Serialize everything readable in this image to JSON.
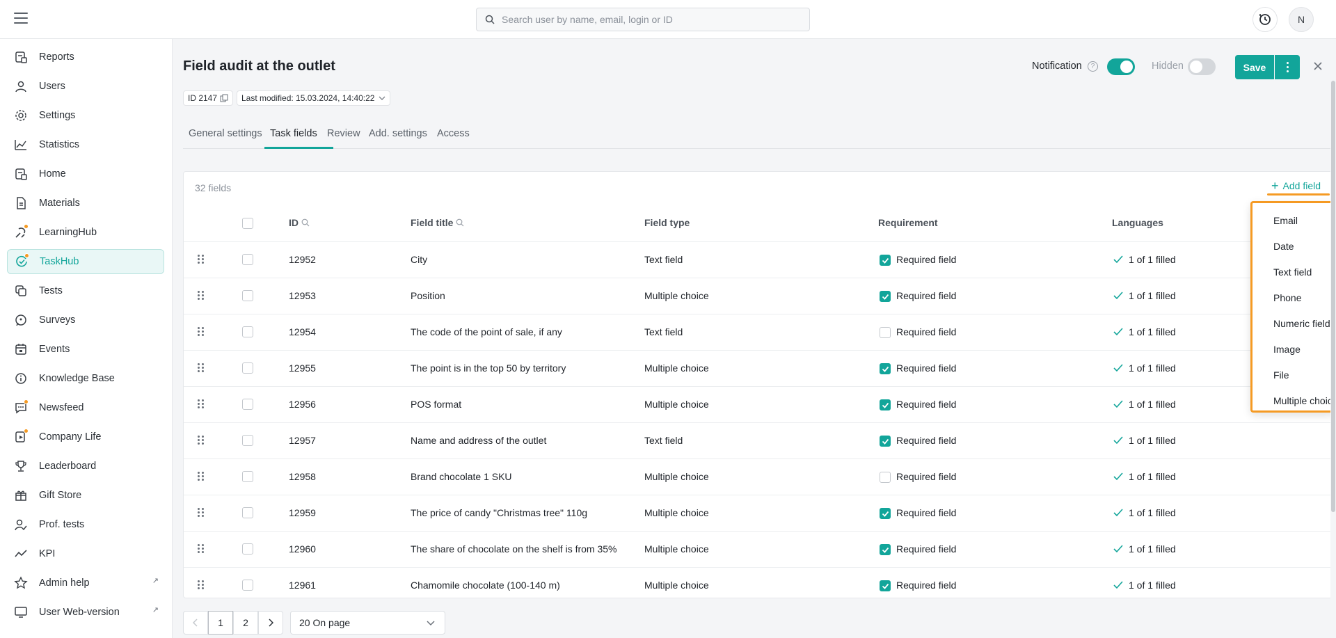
{
  "search": {
    "placeholder": "Search user by name, email, login or ID"
  },
  "user": {
    "avatar_initial": "N"
  },
  "sidebar": {
    "items": [
      {
        "label": "Reports",
        "icon": "reports-icon"
      },
      {
        "label": "Users",
        "icon": "users-icon"
      },
      {
        "label": "Settings",
        "icon": "gear-icon"
      },
      {
        "label": "Statistics",
        "icon": "chart-line-icon"
      },
      {
        "label": "Home",
        "icon": "home-icon"
      },
      {
        "label": "Materials",
        "icon": "document-icon"
      },
      {
        "label": "LearningHub",
        "icon": "learning-icon"
      },
      {
        "label": "TaskHub",
        "icon": "task-check-icon",
        "active": true
      },
      {
        "label": "Tests",
        "icon": "tests-icon"
      },
      {
        "label": "Surveys",
        "icon": "survey-icon"
      },
      {
        "label": "Events",
        "icon": "calendar-icon"
      },
      {
        "label": "Knowledge Base",
        "icon": "info-icon"
      },
      {
        "label": "Newsfeed",
        "icon": "chat-icon"
      },
      {
        "label": "Company Life",
        "icon": "company-icon"
      },
      {
        "label": "Leaderboard",
        "icon": "trophy-icon"
      },
      {
        "label": "Gift Store",
        "icon": "gift-icon"
      },
      {
        "label": "Prof. tests",
        "icon": "user-check-icon"
      },
      {
        "label": "KPI",
        "icon": "kpi-icon"
      },
      {
        "label": "Admin help",
        "icon": "star-icon",
        "external": true
      },
      {
        "label": "User Web-version",
        "icon": "monitor-icon",
        "external": true
      }
    ]
  },
  "header": {
    "title": "Field audit at the outlet",
    "id_label": "ID 2147",
    "last_modified": "Last modified: 15.03.2024, 14:40:22",
    "notification_label": "Notification",
    "help_glyph": "?",
    "notification_on": true,
    "hidden_label": "Hidden",
    "hidden_on": false,
    "save_label": "Save"
  },
  "tabs": [
    {
      "label": "General settings"
    },
    {
      "label": "Task fields",
      "active": true
    },
    {
      "label": "Review"
    },
    {
      "label": "Add. settings"
    },
    {
      "label": "Access"
    }
  ],
  "table": {
    "count_label": "32 fields",
    "add_field_label": "Add field",
    "columns": {
      "id": "ID",
      "title": "Field title",
      "type": "Field type",
      "requirement": "Requirement",
      "languages": "Languages"
    },
    "rows": [
      {
        "id": "12952",
        "title": "City",
        "type": "Text field",
        "required": true,
        "requirement_label": "Required field",
        "languages": "1 of 1 filled"
      },
      {
        "id": "12953",
        "title": "Position",
        "type": "Multiple choice",
        "required": true,
        "requirement_label": "Required field",
        "languages": "1 of 1 filled"
      },
      {
        "id": "12954",
        "title": "The code of the point of sale, if any",
        "type": "Text field",
        "required": false,
        "requirement_label": "Required field",
        "languages": "1 of 1 filled"
      },
      {
        "id": "12955",
        "title": "The point is in the top 50 by territory",
        "type": "Multiple choice",
        "required": true,
        "requirement_label": "Required field",
        "languages": "1 of 1 filled"
      },
      {
        "id": "12956",
        "title": "POS format",
        "type": "Multiple choice",
        "required": true,
        "requirement_label": "Required field",
        "languages": "1 of 1 filled"
      },
      {
        "id": "12957",
        "title": "Name and address of the outlet",
        "type": "Text field",
        "required": true,
        "requirement_label": "Required field",
        "languages": "1 of 1 filled"
      },
      {
        "id": "12958",
        "title": "Brand chocolate 1 SKU",
        "type": "Multiple choice",
        "required": false,
        "requirement_label": "Required field",
        "languages": "1 of 1 filled"
      },
      {
        "id": "12959",
        "title": "The price of candy \"Christmas tree\" 110g",
        "type": "Multiple choice",
        "required": true,
        "requirement_label": "Required field",
        "languages": "1 of 1 filled"
      },
      {
        "id": "12960",
        "title": "The share of chocolate on the shelf is from 35%",
        "type": "Multiple choice",
        "required": true,
        "requirement_label": "Required field",
        "languages": "1 of 1 filled"
      },
      {
        "id": "12961",
        "title": "Chamomile chocolate (100-140 m)",
        "type": "Multiple choice",
        "required": true,
        "requirement_label": "Required field",
        "languages": "1 of 1 filled"
      }
    ]
  },
  "add_field_menu": {
    "options": [
      "Email",
      "Date",
      "Text field",
      "Phone",
      "Numeric field",
      "Image",
      "File",
      "Multiple choic"
    ]
  },
  "pagination": {
    "pages": [
      "1",
      "2"
    ],
    "current": "1",
    "per_page": "20 On page"
  },
  "colors": {
    "accent": "#12a59a",
    "highlight": "#f59a23",
    "badge_dot": "#f59a23"
  }
}
